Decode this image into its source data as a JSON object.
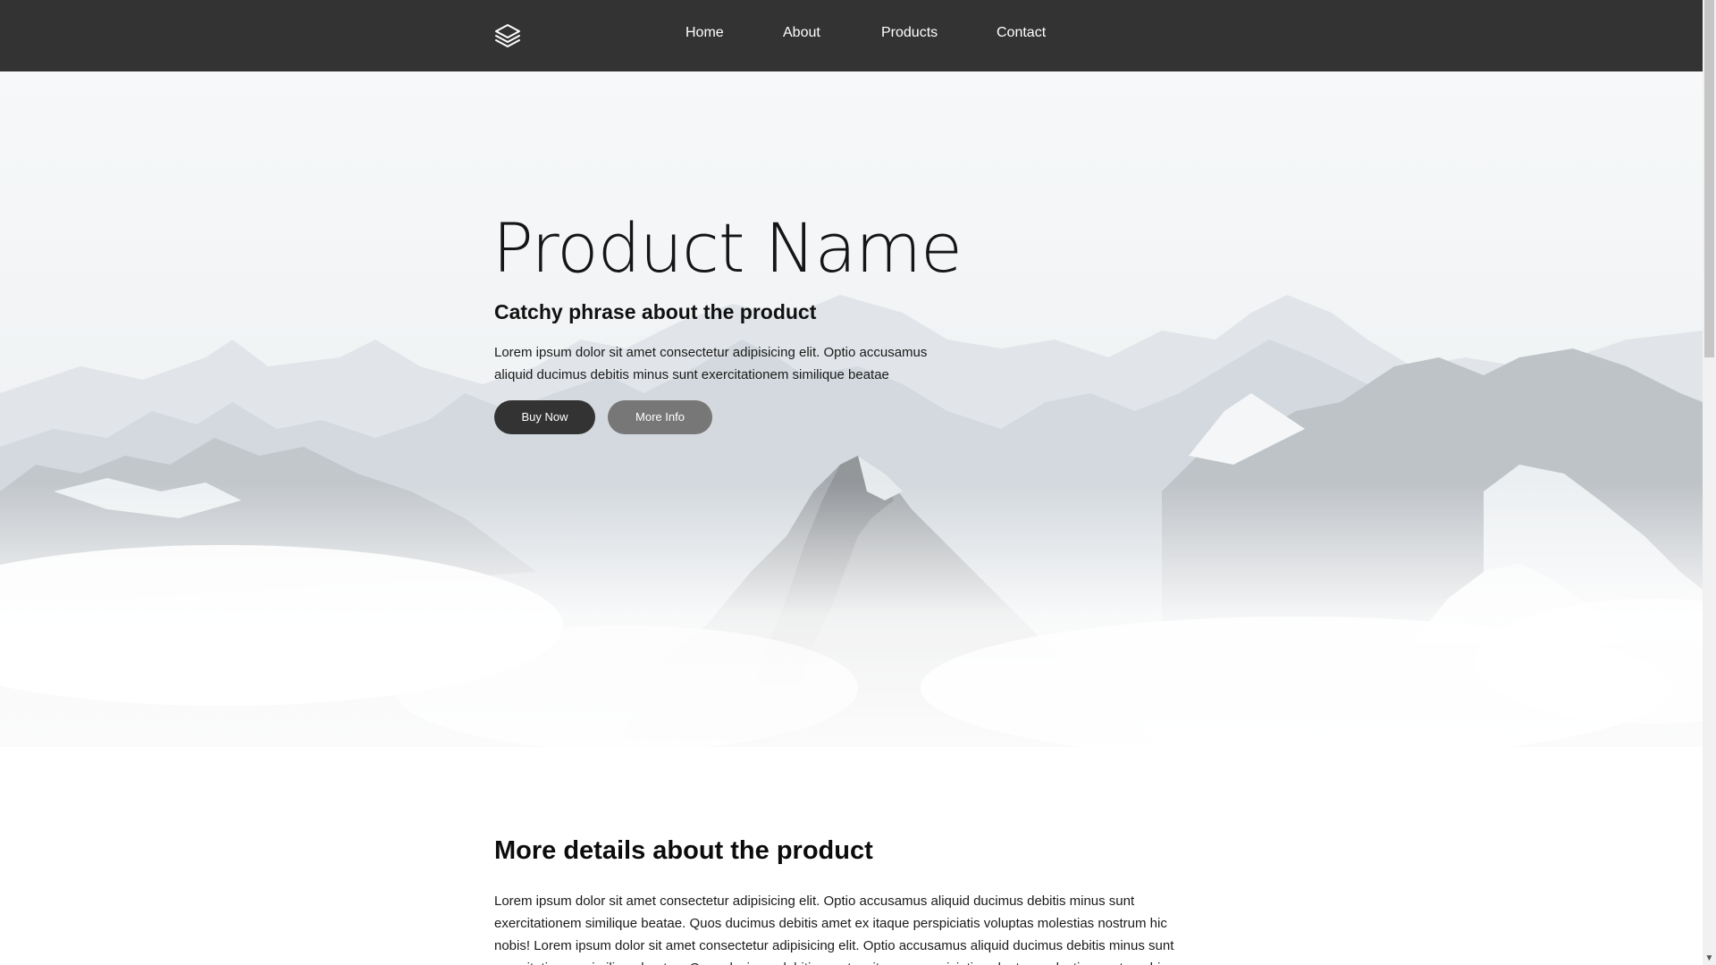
{
  "nav": {
    "logo_icon": "layers-icon",
    "links": [
      "Home",
      "About",
      "Products",
      "Contact"
    ]
  },
  "hero": {
    "title": "Product Name",
    "subtitle": "Catchy phrase about the product",
    "text": "Lorem ipsum dolor sit amet consectetur adipisicing elit. Optio accusamus aliquid ducimus debitis minus sunt exercitationem similique beatae",
    "buy_label": "Buy Now",
    "more_label": "More Info",
    "background_image": "snowy-mountains-photo"
  },
  "details": {
    "title": "More details about the product",
    "text": "Lorem ipsum dolor sit amet consectetur adipisicing elit. Optio accusamus aliquid ducimus debitis minus sunt exercitationem similique beatae. Quos ducimus debitis amet ex itaque perspiciatis voluptas molestias nostrum hic nobis! Lorem ipsum dolor sit amet consectetur adipisicing elit. Optio accusamus aliquid ducimus debitis minus sunt exercitationem similique beatae. Quos ducimus debitis amet ex itaque perspiciatis voluptas molestias nostrum hic"
  },
  "colors": {
    "navbar_bg": "#333333",
    "buy_button": "#333333",
    "more_button": "#777777"
  }
}
